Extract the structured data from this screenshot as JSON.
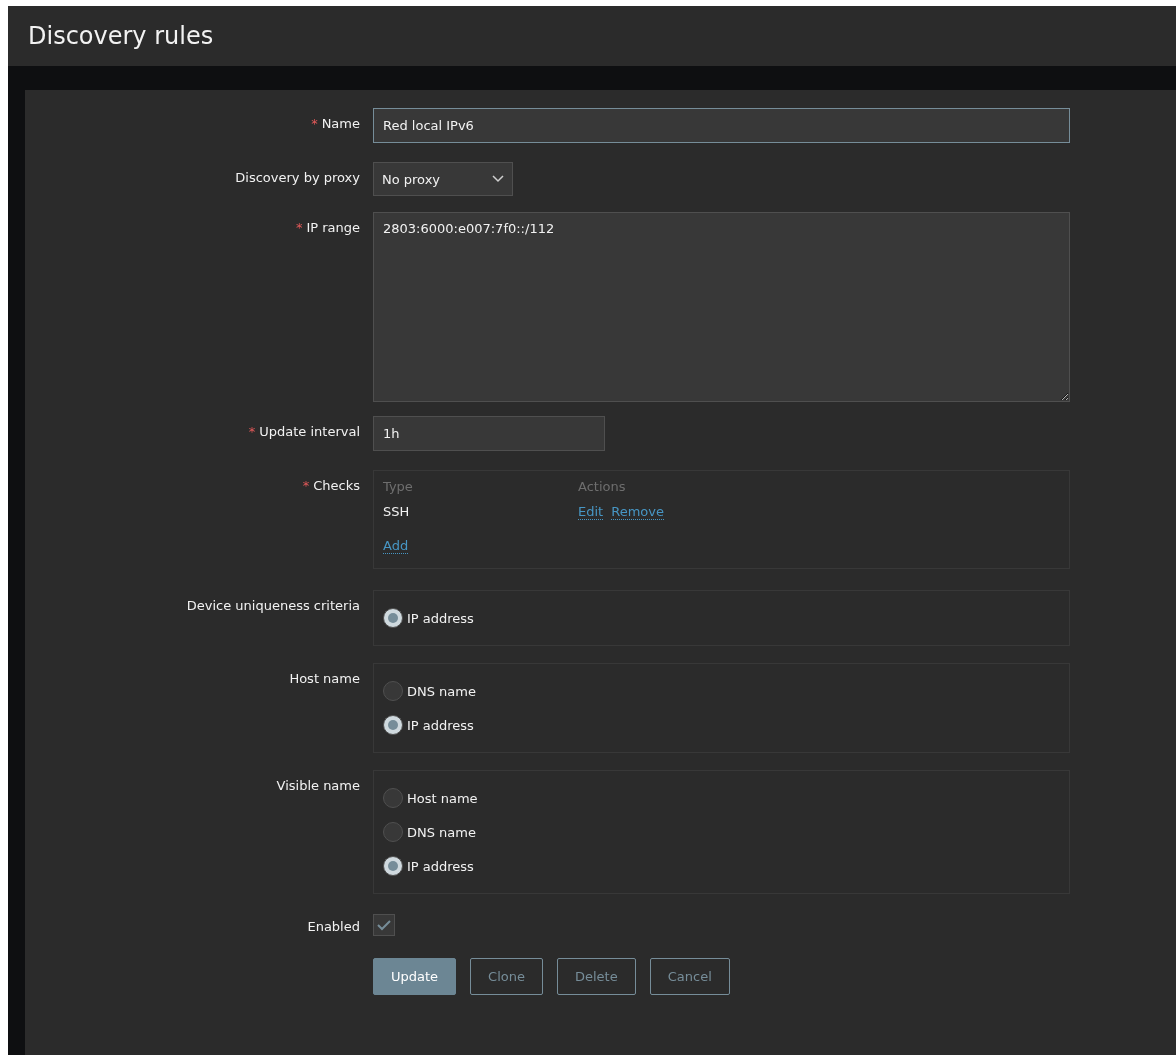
{
  "page_title": "Discovery rules",
  "fields": [
    {
      "kind": "text",
      "label": "Name",
      "required_mark": "*",
      "value": "Red local IPv6",
      "focused": true,
      "wide": true
    },
    {
      "kind": "select",
      "label": "Discovery by proxy",
      "value": "No proxy"
    },
    {
      "kind": "textarea",
      "label": "IP range",
      "required_mark": "*",
      "value": "2803:6000:e007:7f0::/112"
    },
    {
      "kind": "text",
      "label": "Update interval",
      "required_mark": "*",
      "value": "1h",
      "focused": false,
      "wide": false
    },
    {
      "kind": "checks",
      "label": "Checks",
      "required_mark": "*",
      "columns": [
        "Type",
        "Actions"
      ],
      "rows": [
        {
          "type": "SSH",
          "actions": [
            "Edit",
            "Remove"
          ]
        }
      ],
      "add_link": "Add"
    },
    {
      "kind": "radio",
      "label": "Device uniqueness criteria",
      "options": [
        {
          "label": "IP address",
          "selected": true
        }
      ]
    },
    {
      "kind": "radio",
      "label": "Host name",
      "options": [
        {
          "label": "DNS name",
          "selected": false
        },
        {
          "label": "IP address",
          "selected": true
        }
      ]
    },
    {
      "kind": "radio",
      "label": "Visible name",
      "options": [
        {
          "label": "Host name",
          "selected": false
        },
        {
          "label": "DNS name",
          "selected": false
        },
        {
          "label": "IP address",
          "selected": true
        }
      ]
    },
    {
      "kind": "checkbox",
      "label": "Enabled",
      "checked": true
    }
  ],
  "buttons": [
    {
      "label": "Update",
      "primary": true
    },
    {
      "label": "Clone",
      "primary": false
    },
    {
      "label": "Delete",
      "primary": false
    },
    {
      "label": "Cancel",
      "primary": false
    }
  ]
}
